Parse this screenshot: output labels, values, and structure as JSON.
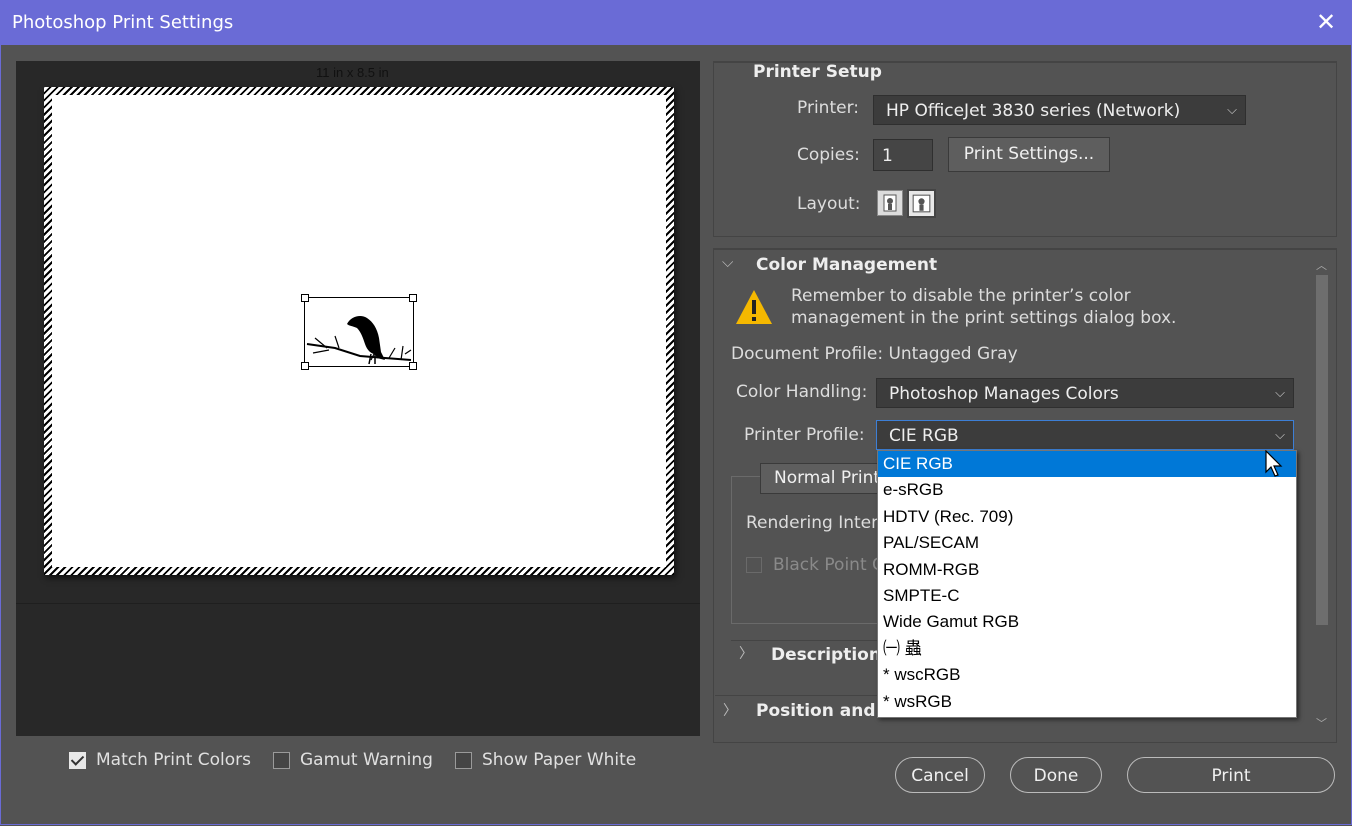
{
  "window": {
    "title": "Photoshop Print Settings",
    "close_label": "✕"
  },
  "preview": {
    "paper_size": "11 in  x 8.5 in"
  },
  "bottom_checks": [
    {
      "label": "Match Print Colors",
      "checked": true
    },
    {
      "label": "Gamut Warning",
      "checked": false
    },
    {
      "label": "Show Paper White",
      "checked": false
    }
  ],
  "printer_setup": {
    "heading": "Printer Setup",
    "printer_label": "Printer:",
    "printer_value": "HP OfficeJet 3830 series (Network)",
    "copies_label": "Copies:",
    "copies_value": "1",
    "print_settings_button": "Print Settings...",
    "layout_label": "Layout:"
  },
  "color_management": {
    "heading": "Color Management",
    "warning_line1": "Remember to disable the printer’s color",
    "warning_line2": "management in the print settings dialog box.",
    "document_profile": "Document Profile: Untagged Gray",
    "color_handling_label": "Color Handling:",
    "color_handling_value": "Photoshop Manages Colors",
    "printer_profile_label": "Printer Profile:",
    "printer_profile_value": "CIE RGB",
    "normal_printing": "Normal Printi",
    "rendering_intent": "Rendering Inten",
    "black_point": "Black Point C"
  },
  "profile_options": [
    "CIE RGB",
    "e-sRGB",
    "HDTV (Rec. 709)",
    "PAL/SECAM",
    "ROMM-RGB",
    "SMPTE-C",
    "Wide Gamut RGB",
    "㈠ 蟲",
    "* wscRGB",
    "* wsRGB"
  ],
  "sections": {
    "description": "Description",
    "position_size": "Position and Si"
  },
  "buttons": {
    "cancel": "Cancel",
    "done": "Done",
    "print": "Print"
  },
  "colors": {
    "titlebar": "#6a6bd6",
    "selection": "#0078d7",
    "dialog_bg": "#535353"
  }
}
